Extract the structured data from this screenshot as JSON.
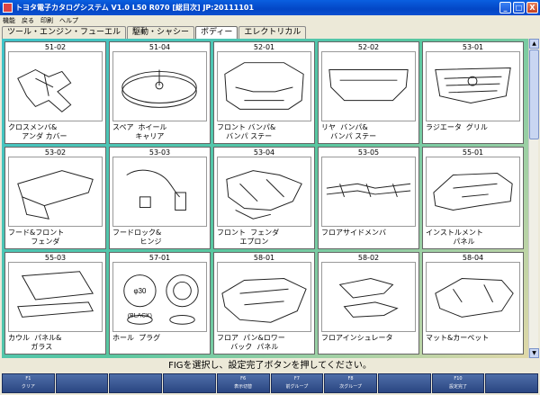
{
  "window": {
    "title": "トヨタ電子カタログシステム V1.0 L50 R070 [総目次] JP:20111101",
    "buttons": [
      "_",
      "□",
      "X"
    ]
  },
  "menu": [
    "機能",
    "戻る",
    "印刷",
    "ヘルプ"
  ],
  "tabs": [
    {
      "label": "ツール・エンジン・フューエル",
      "active": false
    },
    {
      "label": "駆動・シャシー",
      "active": false
    },
    {
      "label": "ボディー",
      "active": true
    },
    {
      "label": "エレクトリカル",
      "active": false
    }
  ],
  "cards": [
    {
      "code": "51-02",
      "label": "クロスメンバ&\n      アンダ カバー",
      "icon": "crossmember"
    },
    {
      "code": "51-04",
      "label": "スペア  ホイール\n          キャリア",
      "icon": "spare-wheel"
    },
    {
      "code": "52-01",
      "label": "フロント バンパ&\n    バンパ ステー",
      "icon": "front-bumper"
    },
    {
      "code": "52-02",
      "label": "リヤ  バンパ&\n    バンパ ステー",
      "icon": "rear-bumper"
    },
    {
      "code": "53-01",
      "label": "ラジエータ  グリル",
      "icon": "grille"
    },
    {
      "code": "53-02",
      "label": "フード&フロント\n          フェンダ",
      "icon": "hood"
    },
    {
      "code": "53-03",
      "label": "フードロック&\n            ヒンジ",
      "icon": "hood-lock"
    },
    {
      "code": "53-04",
      "label": "フロント  フェンダ\n          エプロン",
      "icon": "apron"
    },
    {
      "code": "53-05",
      "label": "フロアサイドメンバ",
      "icon": "floor-side"
    },
    {
      "code": "55-01",
      "label": "インストルメント\n            パネル",
      "icon": "instrument-panel"
    },
    {
      "code": "55-03",
      "label": "カウル  パネル&\n          ガラス",
      "icon": "cowl"
    },
    {
      "code": "57-01",
      "label": "ホール  プラグ",
      "icon": "hole-plug"
    },
    {
      "code": "58-01",
      "label": "フロア  パン&ロワー\n      バック  パネル",
      "icon": "floor-pan"
    },
    {
      "code": "58-02",
      "label": "フロアインシュレータ",
      "icon": "insulator"
    },
    {
      "code": "58-04",
      "label": "マット&カーペット",
      "icon": "mat"
    }
  ],
  "hole_plug_text": {
    "dia": "φ30",
    "color": "(BLACK)"
  },
  "status": "FIGを選択し、設定完了ボタンを押してください。",
  "fkeys": [
    {
      "key": "F1",
      "label": "クリア"
    },
    {
      "key": "",
      "label": ""
    },
    {
      "key": "",
      "label": ""
    },
    {
      "key": "",
      "label": ""
    },
    {
      "key": "F6",
      "label": "表示切替"
    },
    {
      "key": "F7",
      "label": "前グループ"
    },
    {
      "key": "F8",
      "label": "次グループ"
    },
    {
      "key": "",
      "label": ""
    },
    {
      "key": "F10",
      "label": "設定完了"
    },
    {
      "key": "",
      "label": ""
    }
  ],
  "colors": {
    "titlebar": "#0346c5",
    "grid_bg_start": "#3fc3c9",
    "grid_bg_end": "#e0d8a8",
    "fkey": "#2a4682"
  }
}
